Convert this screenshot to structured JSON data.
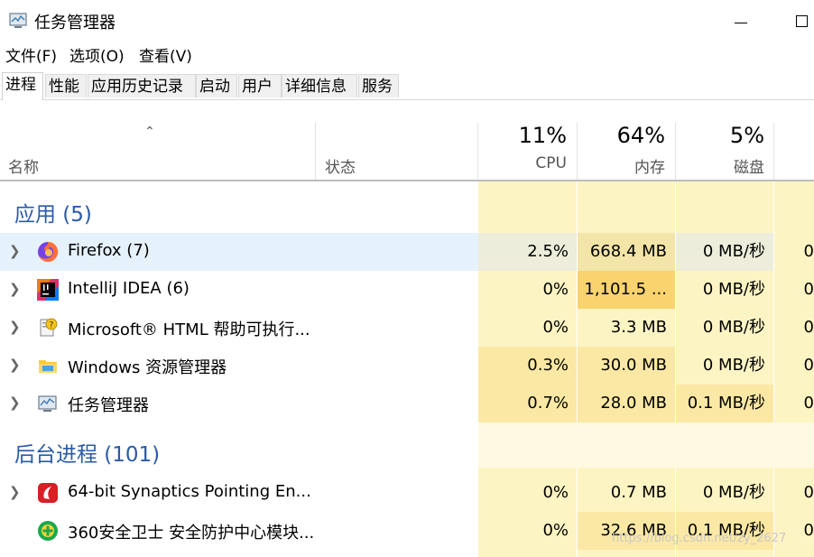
{
  "window": {
    "title": "任务管理器"
  },
  "menu": [
    "文件(F)",
    "选项(O)",
    "查看(V)"
  ],
  "tabs": [
    "进程",
    "性能",
    "应用历史记录",
    "启动",
    "用户",
    "详细信息",
    "服务"
  ],
  "active_tab": 0,
  "columns": {
    "name": "名称",
    "status": "状态",
    "cpu": {
      "percent": "11%",
      "label": "CPU"
    },
    "memory": {
      "percent": "64%",
      "label": "内存"
    },
    "disk": {
      "percent": "5%",
      "label": "磁盘"
    }
  },
  "groups": {
    "apps": {
      "label": "应用 (5)",
      "rows": [
        {
          "name": "Firefox (7)",
          "cpu": "2.5%",
          "memory": "668.4 MB",
          "disk": "0 MB/秒",
          "network": "0",
          "icon": "firefox-icon"
        },
        {
          "name": "IntelliJ IDEA (6)",
          "cpu": "0%",
          "memory": "1,101.5 ...",
          "disk": "0 MB/秒",
          "network": "0",
          "icon": "intellij-icon"
        },
        {
          "name": "Microsoft® HTML 帮助可执行...",
          "cpu": "0%",
          "memory": "3.3 MB",
          "disk": "0 MB/秒",
          "network": "0",
          "icon": "html-help-icon"
        },
        {
          "name": "Windows 资源管理器",
          "cpu": "0.3%",
          "memory": "30.0 MB",
          "disk": "0 MB/秒",
          "network": "0",
          "icon": "folder-icon"
        },
        {
          "name": "任务管理器",
          "cpu": "0.7%",
          "memory": "28.0 MB",
          "disk": "0.1 MB/秒",
          "network": "0",
          "icon": "task-manager-icon"
        }
      ]
    },
    "background": {
      "label": "后台进程 (101)",
      "rows": [
        {
          "name": "64-bit Synaptics Pointing En...",
          "cpu": "0%",
          "memory": "0.7 MB",
          "disk": "0 MB/秒",
          "network": "0",
          "icon": "synaptics-icon"
        },
        {
          "name": "360安全卫士 安全防护中心模块...",
          "cpu": "0%",
          "memory": "32.6 MB",
          "disk": "0.1 MB/秒",
          "network": "0",
          "icon": "360-icon"
        }
      ]
    }
  },
  "watermark": "https://blog.csdn.net/zy_2627",
  "colors": {
    "heat_light": "#fdf4c4",
    "heat_medium": "#fbe8a4",
    "heat_high": "#f9d36e",
    "group_text": "#2a5ba6",
    "selected_row": "#e5f1fb"
  }
}
